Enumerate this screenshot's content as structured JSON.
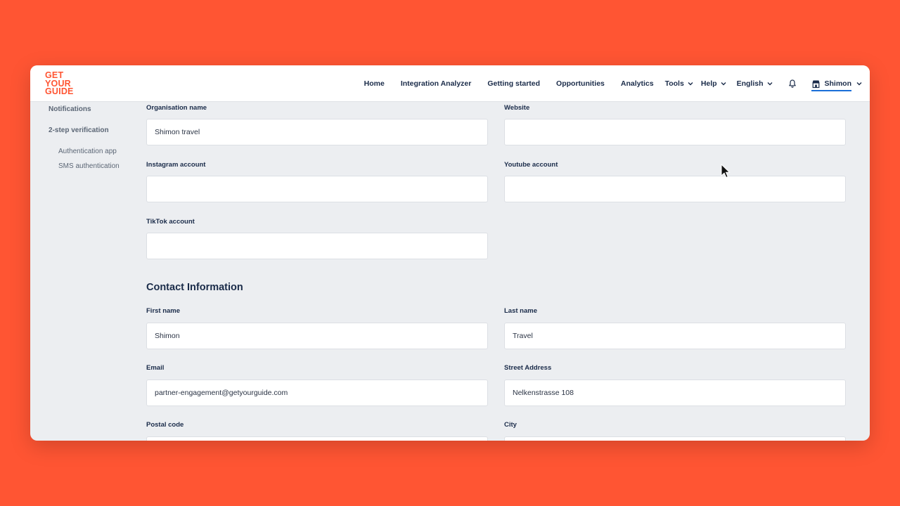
{
  "brand": {
    "logo_lines": [
      "GET",
      "YOUR",
      "GUIDE"
    ]
  },
  "nav": {
    "home": "Home",
    "integration_analyzer": "Integration Analyzer",
    "getting_started": "Getting started",
    "opportunities": "Opportunities",
    "analytics": "Analytics",
    "tools": "Tools",
    "help": "Help",
    "language": "English",
    "user": "Shimon"
  },
  "sidebar": {
    "notifications": "Notifications",
    "two_step": "2-step verification",
    "auth_app": "Authentication app",
    "sms_auth": "SMS authentication"
  },
  "form": {
    "org_name": {
      "label": "Organisation name",
      "value": "Shimon travel"
    },
    "website": {
      "label": "Website",
      "value": ""
    },
    "instagram": {
      "label": "Instagram account",
      "value": ""
    },
    "youtube": {
      "label": "Youtube account",
      "value": ""
    },
    "tiktok": {
      "label": "TikTok account",
      "value": ""
    },
    "contact_title": "Contact Information",
    "first_name": {
      "label": "First name",
      "value": "Shimon"
    },
    "last_name": {
      "label": "Last name",
      "value": "Travel"
    },
    "email": {
      "label": "Email",
      "value": "partner-engagement@getyourguide.com"
    },
    "street": {
      "label": "Street Address",
      "value": "Nelkenstrasse 108"
    },
    "postal": {
      "label": "Postal code",
      "value": ""
    },
    "city": {
      "label": "City",
      "value": ""
    }
  },
  "colors": {
    "brand": "#ff5533",
    "text": "#1a2b49",
    "underline": "#1a6fd8"
  }
}
